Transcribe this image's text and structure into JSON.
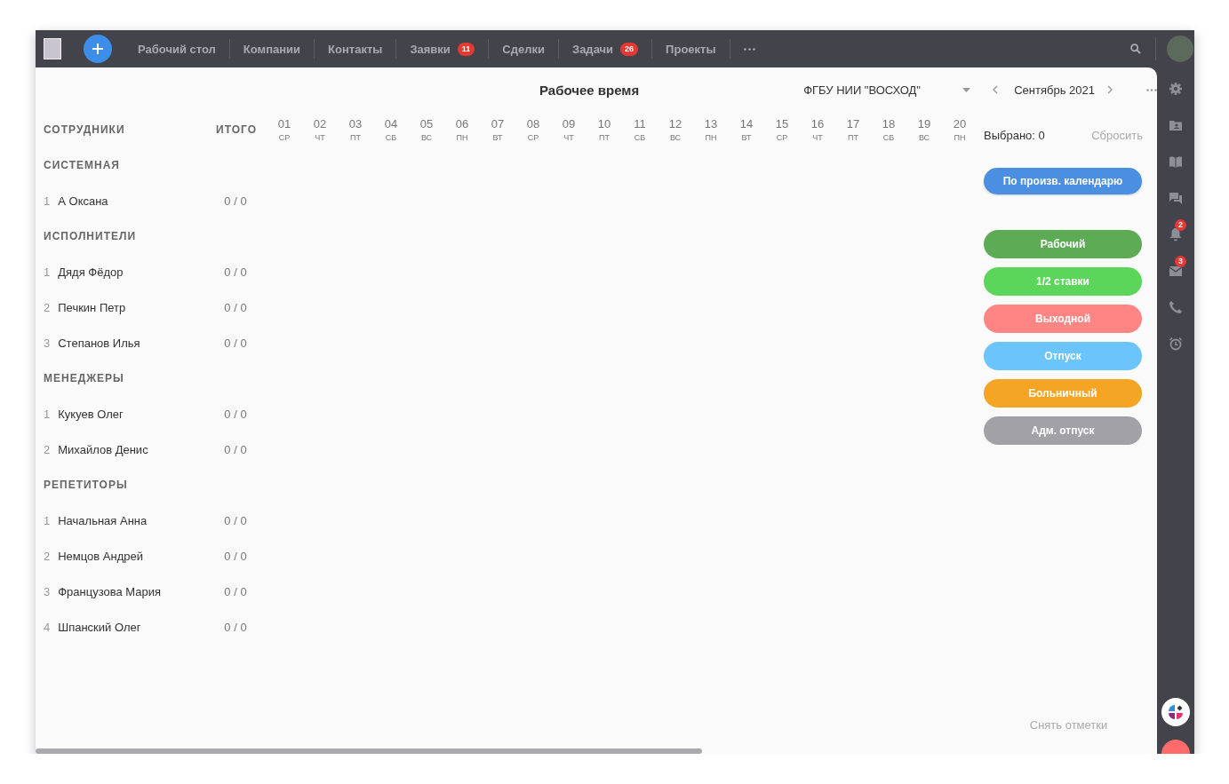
{
  "nav": [
    {
      "label": "Рабочий стол"
    },
    {
      "label": "Компании"
    },
    {
      "label": "Контакты"
    },
    {
      "label": "Заявки",
      "badge": "11"
    },
    {
      "label": "Сделки"
    },
    {
      "label": "Задачи",
      "badge": "26"
    },
    {
      "label": "Проекты"
    }
  ],
  "rail_badges": {
    "notifications": "2",
    "mail": "3"
  },
  "title": "Рабочее время",
  "organization": "ФГБУ НИИ \"ВОСХОД\"",
  "month": "Сентябрь 2021",
  "columns": {
    "employees": "СОТРУДНИКИ",
    "total": "ИТОГО"
  },
  "days": [
    {
      "day": "01",
      "weekday": "СР"
    },
    {
      "day": "02",
      "weekday": "ЧТ"
    },
    {
      "day": "03",
      "weekday": "ПТ"
    },
    {
      "day": "04",
      "weekday": "СБ"
    },
    {
      "day": "05",
      "weekday": "ВС"
    },
    {
      "day": "06",
      "weekday": "ПН"
    },
    {
      "day": "07",
      "weekday": "ВТ"
    },
    {
      "day": "08",
      "weekday": "СР"
    },
    {
      "day": "09",
      "weekday": "ЧТ"
    },
    {
      "day": "10",
      "weekday": "ПТ"
    },
    {
      "day": "11",
      "weekday": "СБ"
    },
    {
      "day": "12",
      "weekday": "ВС"
    },
    {
      "day": "13",
      "weekday": "ПН"
    },
    {
      "day": "14",
      "weekday": "ВТ"
    },
    {
      "day": "15",
      "weekday": "СР"
    },
    {
      "day": "16",
      "weekday": "ЧТ"
    },
    {
      "day": "17",
      "weekday": "ПТ"
    },
    {
      "day": "18",
      "weekday": "СБ"
    },
    {
      "day": "19",
      "weekday": "ВС"
    },
    {
      "day": "20",
      "weekday": "ПН"
    }
  ],
  "groups": [
    {
      "title": "СИСТЕМНАЯ",
      "employees": [
        {
          "index": "1",
          "name": "А Оксана",
          "total": "0 / 0"
        }
      ]
    },
    {
      "title": "ИСПОЛНИТЕЛИ",
      "employees": [
        {
          "index": "1",
          "name": "Дядя Фёдор",
          "total": "0 / 0"
        },
        {
          "index": "2",
          "name": "Печкин Петр",
          "total": "0 / 0"
        },
        {
          "index": "3",
          "name": "Степанов Илья",
          "total": "0 / 0"
        }
      ]
    },
    {
      "title": "МЕНЕДЖЕРЫ",
      "employees": [
        {
          "index": "1",
          "name": "Кукуев Олег",
          "total": "0 / 0"
        },
        {
          "index": "2",
          "name": "Михайлов Денис",
          "total": "0 / 0"
        }
      ]
    },
    {
      "title": "РЕПЕТИТОРЫ",
      "employees": [
        {
          "index": "1",
          "name": "Начальная Анна",
          "total": "0 / 0"
        },
        {
          "index": "2",
          "name": "Немцов Андрей",
          "total": "0 / 0"
        },
        {
          "index": "3",
          "name": "Французова Мария",
          "total": "0 / 0"
        },
        {
          "index": "4",
          "name": "Шпанский Олег",
          "total": "0 / 0"
        }
      ]
    }
  ],
  "selection": {
    "label": "Выбрано: 0",
    "reset": "Сбросить"
  },
  "calendar_button": "По произв. календарю",
  "statuses": [
    {
      "label": "Рабочий",
      "color": "#5dab55"
    },
    {
      "label": "1/2 ставки",
      "color": "#5cd65a"
    },
    {
      "label": "Выходной",
      "color": "#ff8585"
    },
    {
      "label": "Отпуск",
      "color": "#6cc4fd"
    },
    {
      "label": "Больничный",
      "color": "#f4a523"
    },
    {
      "label": "Адм. отпуск",
      "color": "#a1a1a6"
    }
  ],
  "clear_marks": "Снять отметки"
}
